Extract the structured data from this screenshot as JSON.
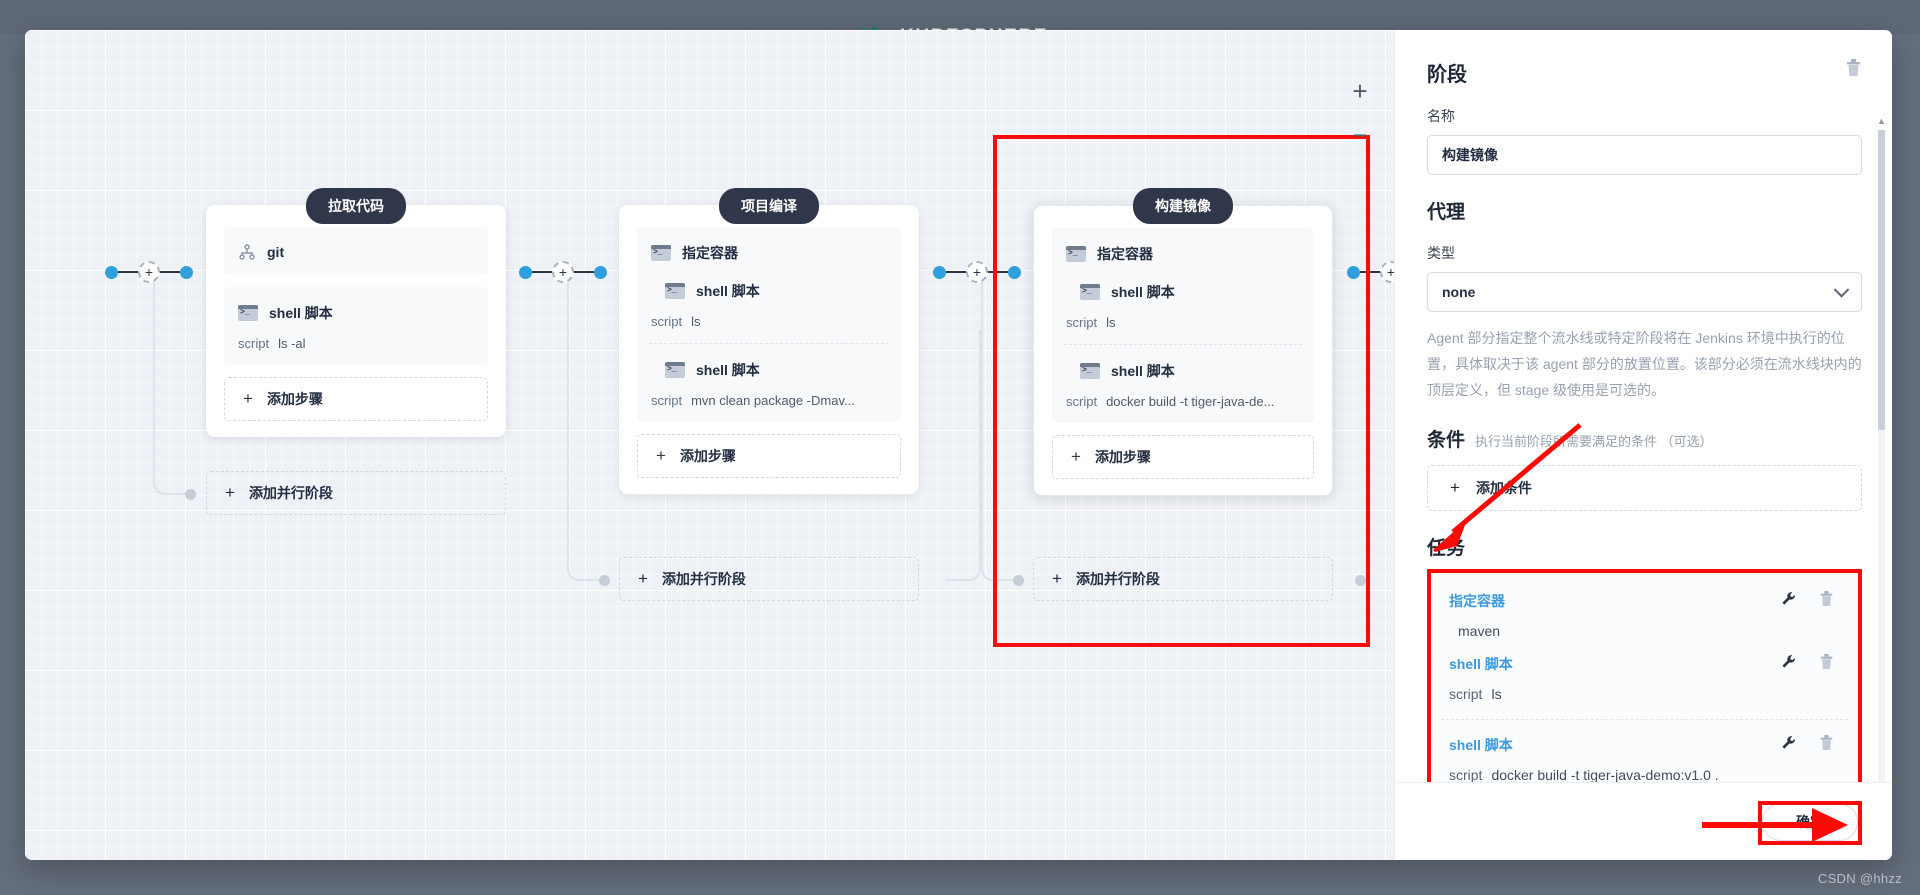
{
  "brand": {
    "name": "KUBESPHERE"
  },
  "canvas": {
    "zoom_in": "+",
    "zoom_out": "−",
    "add_parallel_label": "添加并行阶段",
    "add_step_label": "添加步骤",
    "plus": "+",
    "stages": [
      {
        "title": "拉取代码",
        "steps": [
          {
            "icon": "git-icon",
            "name": "git",
            "script_label": "",
            "script": ""
          },
          {
            "icon": "terminal-icon",
            "name": "shell 脚本",
            "script_label": "script",
            "script": "ls -al"
          }
        ]
      },
      {
        "title": "项目编译",
        "steps": [
          {
            "icon": "terminal-icon",
            "name": "指定容器",
            "script_label": "",
            "script": ""
          },
          {
            "icon": "terminal-icon",
            "name": "shell 脚本",
            "script_label": "script",
            "script": "ls"
          },
          {
            "icon": "terminal-icon",
            "name": "shell 脚本",
            "script_label": "script",
            "script": "mvn clean package -Dmav..."
          }
        ]
      },
      {
        "title": "构建镜像",
        "steps": [
          {
            "icon": "terminal-icon",
            "name": "指定容器",
            "script_label": "",
            "script": ""
          },
          {
            "icon": "terminal-icon",
            "name": "shell 脚本",
            "script_label": "script",
            "script": "ls"
          },
          {
            "icon": "terminal-icon",
            "name": "shell 脚本",
            "script_label": "script",
            "script": "docker build -t tiger-java-de..."
          }
        ]
      }
    ]
  },
  "panel": {
    "title": "阶段",
    "delete_icon": "trash-icon",
    "name_label": "名称",
    "name_value": "构建镜像",
    "agent_section": "代理",
    "type_label": "类型",
    "type_value": "none",
    "agent_desc": "Agent 部分指定整个流水线或特定阶段将在 Jenkins 环境中执行的位置，具体取决于该 agent 部分的放置位置。该部分必须在流水线块内的顶层定义，但 stage 级使用是可选的。",
    "condition_title": "条件",
    "condition_hint": "执行当前阶段所需要满足的条件 （可选）",
    "add_condition_label": "添加条件",
    "tasks_title": "任务",
    "tasks": [
      {
        "name": "指定容器",
        "value_label": "",
        "value": "maven"
      },
      {
        "name": "shell 脚本",
        "value_label": "script",
        "value": "ls"
      },
      {
        "name": "shell 脚本",
        "value_label": "script",
        "value": "docker build -t tiger-java-demo:v1.0 ."
      }
    ],
    "edit_icon": "wrench-icon",
    "delete_task_icon": "trash-icon",
    "confirm_label": "确定"
  },
  "colors": {
    "accent_red": "#fb0a06",
    "link_blue": "#3a9ae0",
    "node_blue": "#2fa0dd",
    "dark": "#31374a"
  },
  "watermark": "CSDN @hhzz"
}
